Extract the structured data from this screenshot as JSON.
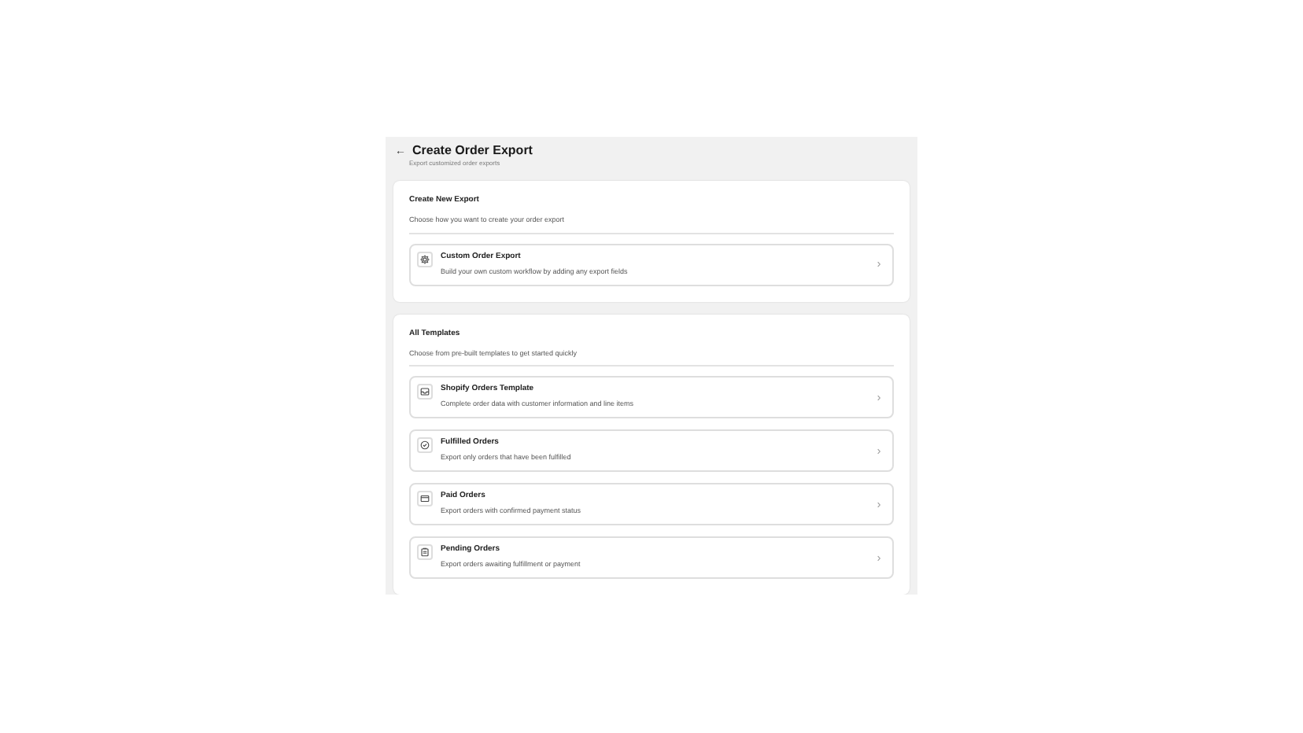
{
  "header": {
    "back": "←",
    "title": "Create Order Export",
    "subtitle": "Export customized order exports"
  },
  "sections": [
    {
      "title": "Create New Export",
      "description": "Choose how you want to create your order export",
      "items": [
        {
          "kind": "gear",
          "title": "Custom Order Export",
          "description": "Build your own custom workflow by adding any export fields"
        }
      ]
    },
    {
      "title": "All Templates",
      "description": "Choose from pre-built templates to get started quickly",
      "items": [
        {
          "kind": "tray",
          "title": "Shopify Orders Template",
          "description": "Complete order data with customer information and line items"
        },
        {
          "kind": "check",
          "title": "Fulfilled Orders",
          "description": "Export only orders that have been fulfilled"
        },
        {
          "kind": "card",
          "title": "Paid Orders",
          "description": "Export orders with confirmed payment status"
        },
        {
          "kind": "clipboard",
          "title": "Pending Orders",
          "description": "Export orders awaiting fulfillment or payment"
        }
      ]
    }
  ]
}
